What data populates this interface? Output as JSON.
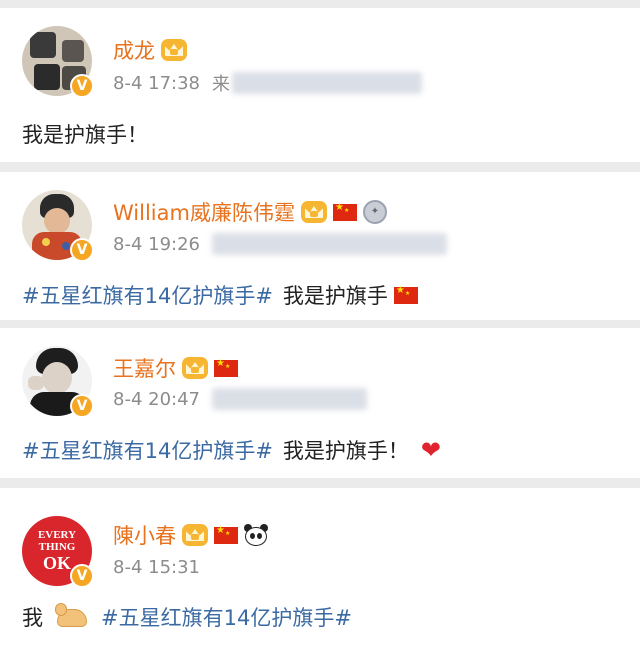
{
  "posts": [
    {
      "name": "成龙",
      "badges": [
        "vip-crown-icon"
      ],
      "timestamp": "8-4 17:38",
      "source_prefix": "来",
      "content_plain": "我是护旗手！",
      "content_tag": ""
    },
    {
      "name": "William威廉陈伟霆",
      "badges": [
        "vip-crown-icon",
        "china-flag-icon",
        "medal-icon"
      ],
      "timestamp": "8-4 19:26",
      "source_prefix": "",
      "content_tag": "#五星红旗有14亿护旗手#",
      "content_plain": "我是护旗手"
    },
    {
      "name": "王嘉尔",
      "badges": [
        "vip-crown-icon",
        "china-flag-icon"
      ],
      "timestamp": "8-4 20:47",
      "source_prefix": "",
      "content_tag": "#五星红旗有14亿护旗手#",
      "content_plain": "我是护旗手！"
    },
    {
      "name": "陳小春",
      "badges": [
        "vip-crown-icon",
        "china-flag-icon",
        "panda-icon"
      ],
      "timestamp": "8-4 15:31",
      "source_prefix": "",
      "content_plain": "我",
      "content_tag": "#五星红旗有14亿护旗手#",
      "avatar_text": [
        "EVERY",
        "THING",
        "OK"
      ]
    }
  ],
  "verified_mark": "V",
  "colors": {
    "name": "#e8721d",
    "hashtag": "#3b6aa3",
    "meta": "#8c8c8c",
    "verified": "#f5a623"
  }
}
